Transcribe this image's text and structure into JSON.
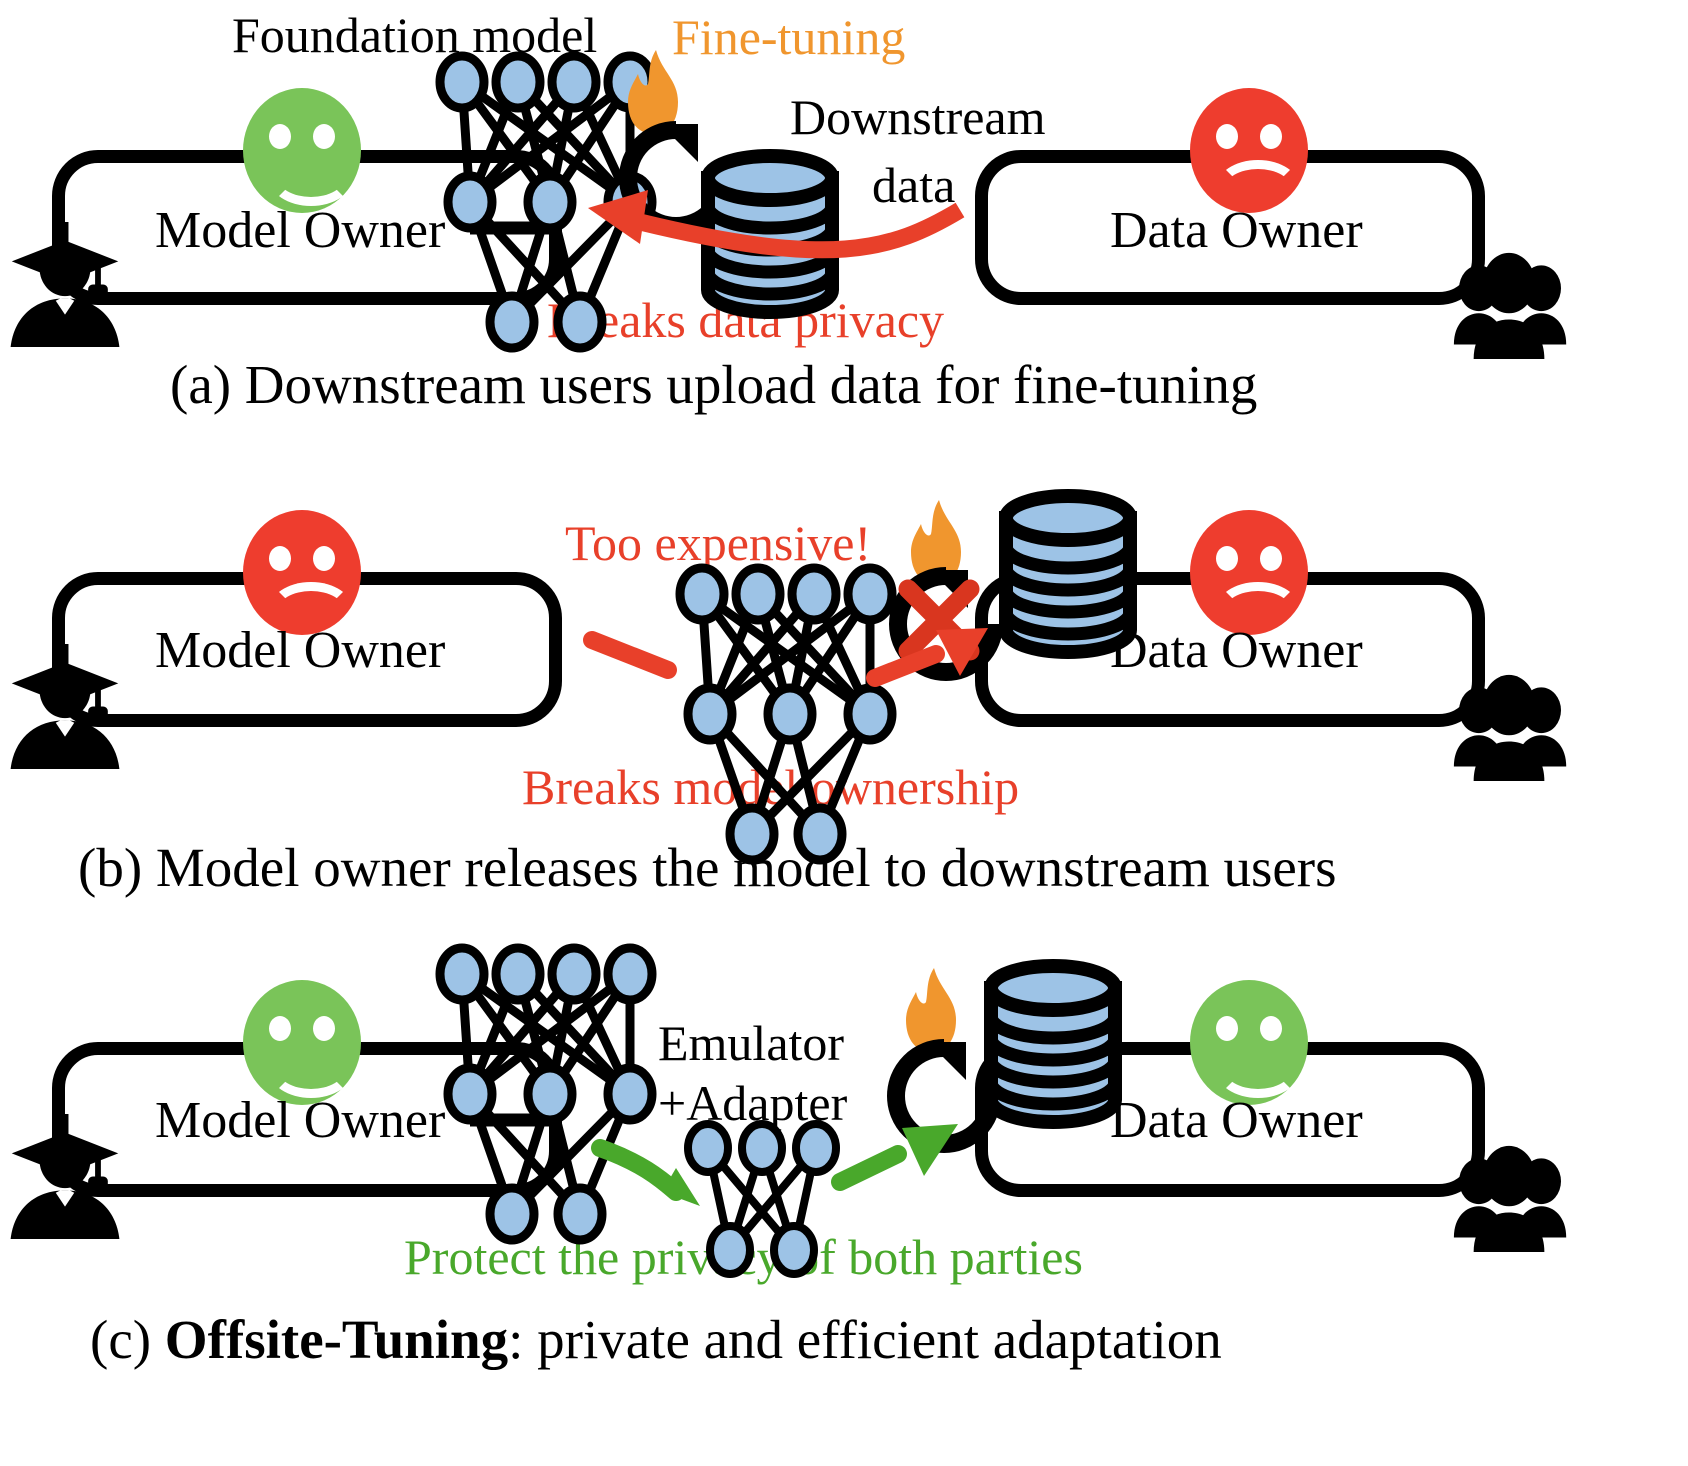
{
  "figure": {
    "panels": [
      {
        "id": "a",
        "caption": "(a)  Downstream users upload data for fine-tuning",
        "model_owner_label": "Model Owner",
        "data_owner_label": "Data Owner",
        "model_owner_mood": "happy",
        "data_owner_mood": "sad",
        "annotations": {
          "foundation_model": "Foundation  model",
          "fine_tuning": "Fine-tuning",
          "downstream_line1": "Downstream",
          "downstream_line2": "data",
          "verdict": "Breaks data privacy"
        },
        "verdict_color": "#e8402a",
        "arrow_color": "#e8402a",
        "arrow_direction": "data-to-model"
      },
      {
        "id": "b",
        "caption": "(b)  Model owner releases the model to downstream users",
        "model_owner_label": "Model Owner",
        "data_owner_label": "Data Owner",
        "model_owner_mood": "sad",
        "data_owner_mood": "sad",
        "annotations": {
          "too_expensive": "Too expensive!",
          "verdict": "Breaks model ownership"
        },
        "verdict_color": "#e8402a",
        "arrow_color": "#e8402a",
        "arrow_direction": "model-to-data",
        "fine_tuning_blocked": true
      },
      {
        "id": "c",
        "caption_prefix": "(c) ",
        "caption_bold": "Offsite-Tuning",
        "caption_rest": ": private and efficient adaptation",
        "model_owner_label": "Model Owner",
        "data_owner_label": "Data Owner",
        "model_owner_mood": "happy",
        "data_owner_mood": "happy",
        "annotations": {
          "emulator_line1": "Emulator",
          "emulator_line2": "+Adapter",
          "verdict": "Protect the privacy of both parties"
        },
        "verdict_color": "#49a82b",
        "arrow_color": "#49a82b",
        "arrow_direction": "model-to-data",
        "fine_tuning_blocked": false
      }
    ],
    "icons": {
      "model_owner_person": "graduate-icon",
      "data_owner_person": "user-group-icon",
      "model": "neural-network-icon",
      "adapter": "small-neural-network-icon",
      "data": "database-cylinder-icon",
      "tuning": "flame-refresh-icon",
      "blocked": "red-cross-icon",
      "happy": "smiley-happy-icon",
      "sad": "smiley-sad-icon"
    },
    "colors": {
      "happy": "#7ac459",
      "sad": "#ee3d2e",
      "red_accent": "#e8402a",
      "green_accent": "#49a82b",
      "orange_accent": "#f0962e",
      "node_fill": "#9dc3e6",
      "outline": "#000000"
    },
    "network": {
      "full_layers": [
        4,
        3,
        2
      ],
      "adapter_layers": [
        3,
        2
      ]
    }
  }
}
